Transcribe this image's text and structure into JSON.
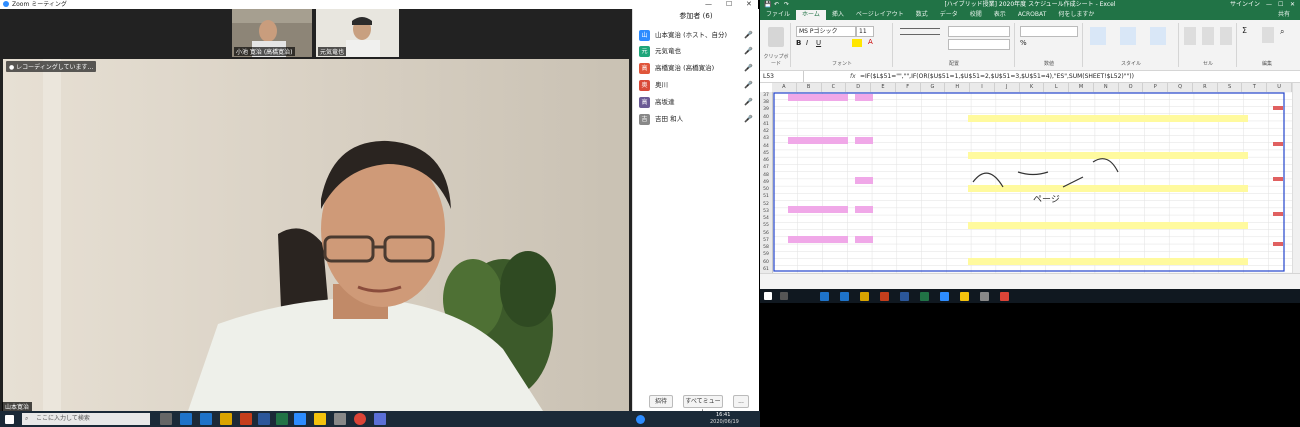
{
  "zoom": {
    "title": "Zoom ミーティング",
    "recording_badge": "● レコーディングしています...",
    "main_name_tag": "山本寛治",
    "thumbs": [
      {
        "name": "小池 寛治 (高橋寛治)"
      },
      {
        "name": "元気竜也"
      }
    ],
    "panel_title": "参加者 (6)",
    "participants": [
      {
        "name": "山本寛治 (ホスト、自分)",
        "initial": "山",
        "color": "#2d8cff"
      },
      {
        "name": "元気竜也",
        "initial": "元",
        "color": "#1fa67a"
      },
      {
        "name": "高橋寛治 (高橋寛治)",
        "initial": "高",
        "color": "#e0563b"
      },
      {
        "name": "奥川",
        "initial": "奥",
        "color": "#d94a3a"
      },
      {
        "name": "高坂達",
        "initial": "高",
        "color": "#6b5b95"
      },
      {
        "name": "吉田 和人",
        "initial": "吉",
        "color": "#888"
      }
    ],
    "invite_label": "招待",
    "mute_all_label": "すべてミュート",
    "more_label": "..."
  },
  "excel": {
    "title": "[ハイブリッド授業] 2020年度 スケジュール作成シート - Excel",
    "tabs": [
      "ファイル",
      "ホーム",
      "挿入",
      "ページレイアウト",
      "数式",
      "データ",
      "校閲",
      "表示",
      "ACROBAT",
      "何をしますか"
    ],
    "active_tab": "ホーム",
    "sign_in": "サインイン",
    "share": "共有",
    "font_name": "MS Pゴシック",
    "font_size": "11",
    "ribbon_groups": [
      "クリップボード",
      "フォント",
      "配置",
      "数値",
      "スタイル",
      "セル",
      "編集"
    ],
    "name_box": "L53",
    "formula": "=IF($L$51=\"\",\"\",IF(OR($U$51=1,$U$51=2,$U$51=3,$U$51=4),\"ES\",SUM(SHEET!$L52)\"\"))",
    "columns": [
      "A",
      "B",
      "C",
      "D",
      "E",
      "F",
      "G",
      "H",
      "I",
      "J",
      "K",
      "L",
      "M",
      "N",
      "O",
      "P",
      "Q",
      "R",
      "S",
      "T",
      "U"
    ],
    "rows": [
      "37",
      "38",
      "39",
      "40",
      "41",
      "42",
      "43",
      "44",
      "45",
      "46",
      "47",
      "48",
      "49",
      "50",
      "51",
      "52",
      "53",
      "54",
      "55",
      "56",
      "57",
      "58",
      "59",
      "60",
      "61"
    ],
    "annotation": "ページ"
  },
  "taskbar": {
    "search_placeholder": "ここに入力して検索",
    "time": "16:41",
    "date": "2020/06/19"
  }
}
